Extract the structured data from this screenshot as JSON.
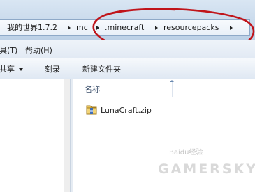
{
  "address_bar": {
    "crumbs": [
      "我的世界1.7.2",
      "mc",
      ".minecraft",
      "resourcepacks"
    ],
    "highlight_color": "#c0141a"
  },
  "menu": {
    "items": [
      "具(T)",
      "帮助(H)"
    ]
  },
  "toolbar": {
    "share_label": "共享",
    "burn_label": "刻录",
    "new_folder_label": "新建文件夹"
  },
  "content": {
    "column_header": "名称",
    "files": [
      {
        "name": "LunaCraft.zip",
        "icon": "zip-archive-icon"
      }
    ]
  },
  "watermarks": {
    "baidu": "Baidu经验",
    "gamersky": "GAMERSKY"
  }
}
